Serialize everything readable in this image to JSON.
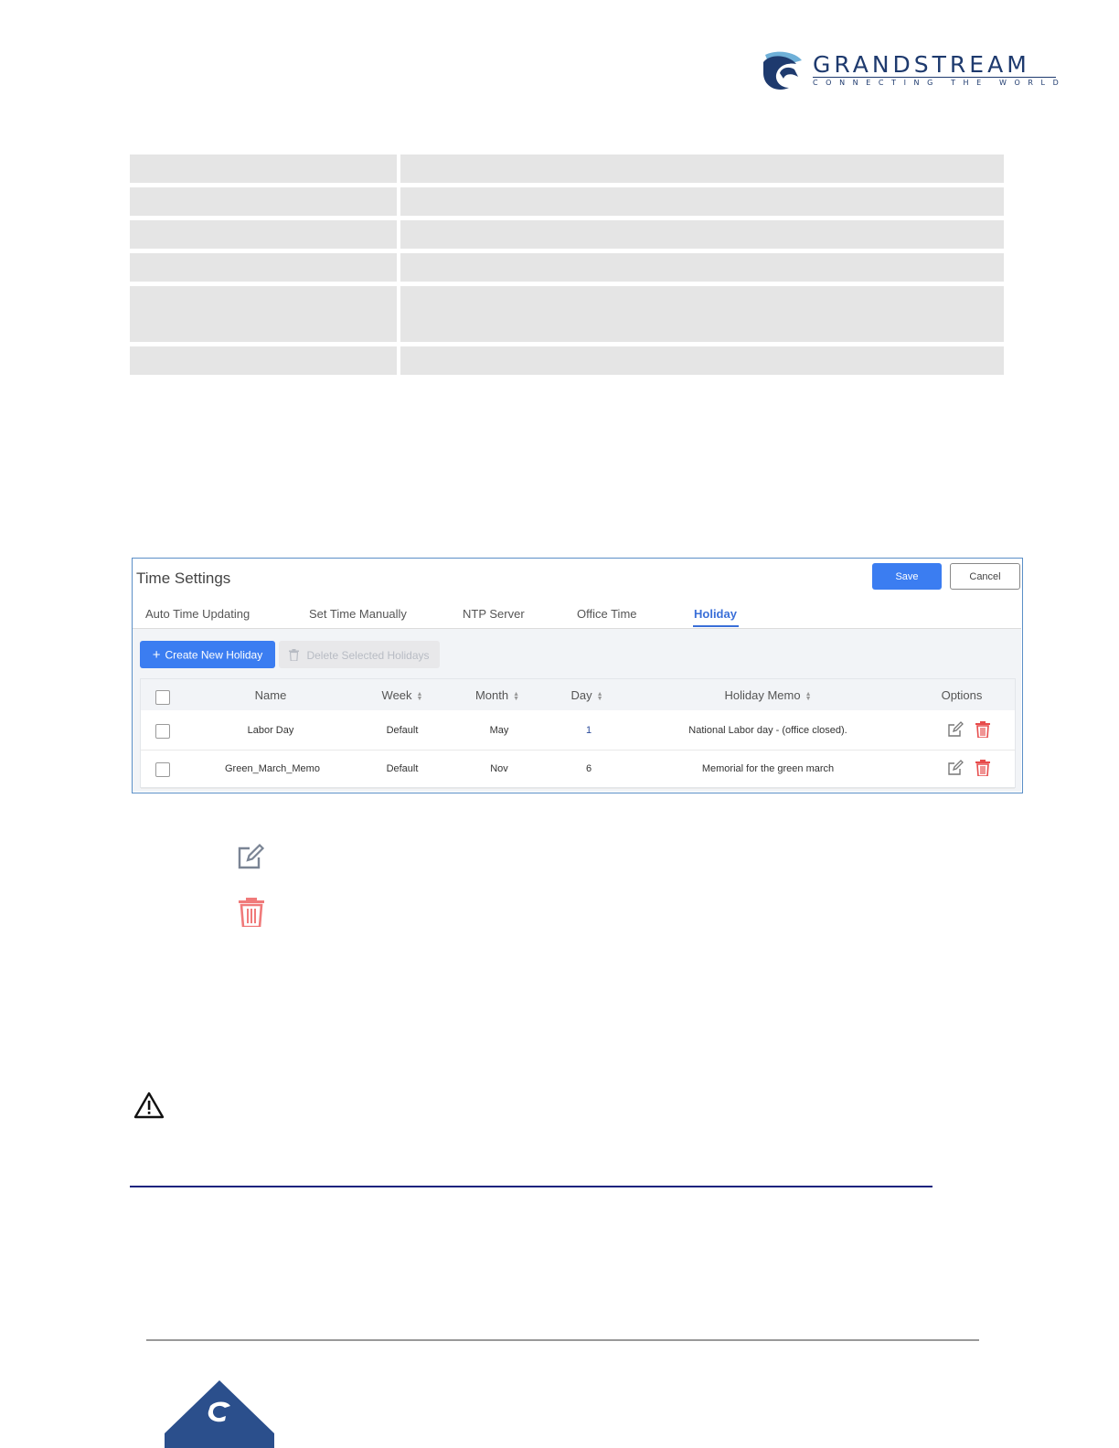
{
  "logo": {
    "wordmark": "GRANDSTREAM",
    "tagline": "CONNECTING THE WORLD",
    "brand_color": "#1e3a6e"
  },
  "time_settings": {
    "title": "Time Settings",
    "save_label": "Save",
    "cancel_label": "Cancel",
    "tabs": [
      {
        "label": "Auto Time Updating",
        "active": false
      },
      {
        "label": "Set Time Manually",
        "active": false
      },
      {
        "label": "NTP Server",
        "active": false
      },
      {
        "label": "Office Time",
        "active": false
      },
      {
        "label": "Holiday",
        "active": true
      }
    ],
    "create_label": "Create New Holiday",
    "delete_selected_label": "Delete Selected Holidays",
    "columns": [
      "Name",
      "Week",
      "Month",
      "Day",
      "Holiday Memo",
      "Options"
    ],
    "rows": [
      {
        "name": "Labor Day",
        "week": "Default",
        "month": "May",
        "day": "1",
        "memo": "National Labor day - (office closed)."
      },
      {
        "name": "Green_March_Memo",
        "week": "Default",
        "month": "Nov",
        "day": "6",
        "memo": "Memorial for the green march"
      }
    ],
    "accent_color": "#3b7df1",
    "delete_color": "#e74c4c"
  },
  "legend": {
    "edit_icon": "edit-icon",
    "delete_icon": "trash-icon"
  },
  "warning": {
    "icon": "warning-icon"
  }
}
